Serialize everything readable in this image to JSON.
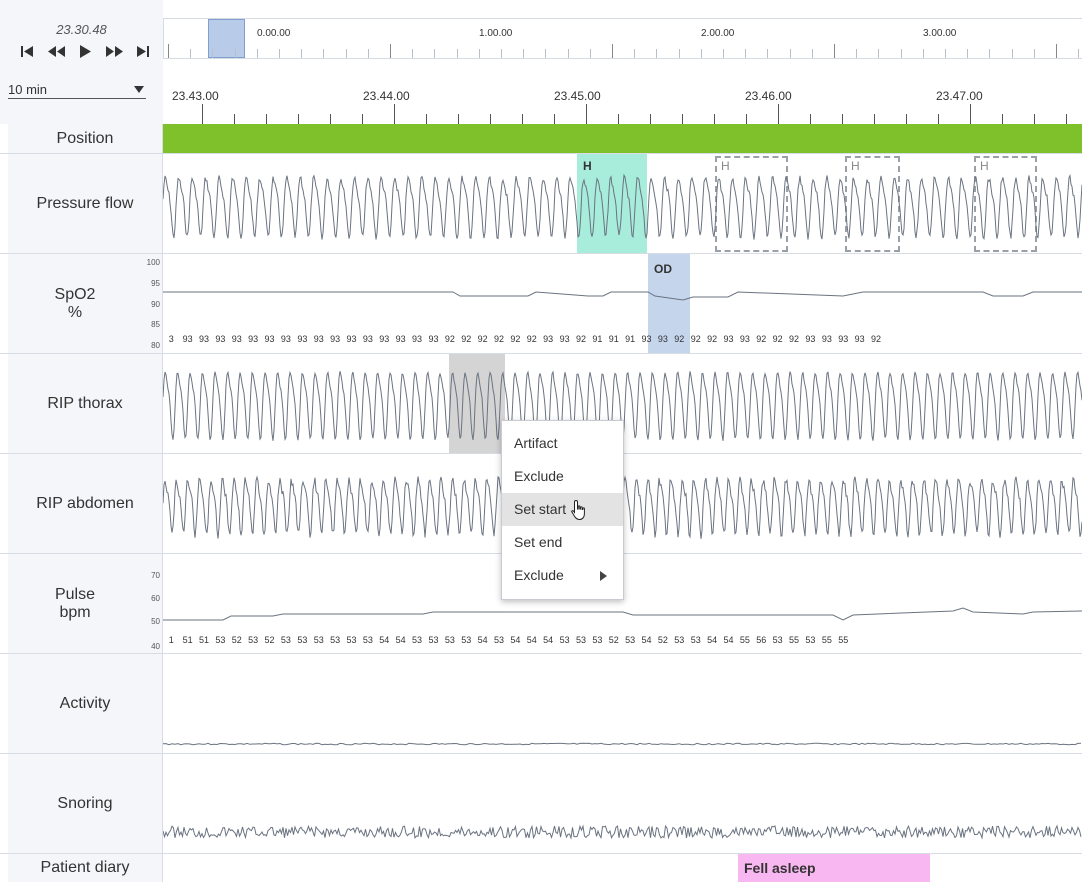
{
  "header": {
    "current_time": "23.30.48",
    "zoom_level": "10 min"
  },
  "transport": {
    "icons": [
      "skip-to-start-icon",
      "rewind-icon",
      "play-icon",
      "fast-forward-icon",
      "skip-to-end-icon"
    ]
  },
  "overview": {
    "labels": [
      "0.00.00",
      "1.00.00",
      "2.00.00",
      "3.00.00"
    ]
  },
  "timeaxis": {
    "labels": [
      "23.43.00",
      "23.44.00",
      "23.45.00",
      "23.46.00",
      "23.47.00"
    ]
  },
  "tracks": {
    "position": {
      "label": "Position",
      "color": "#7ec12a"
    },
    "pressure_flow": {
      "label": "Pressure flow",
      "events": [
        "H",
        "H",
        "H",
        "H"
      ],
      "highlight_color": "#a8ecdc"
    },
    "spo2": {
      "label": "SpO2",
      "unit": "%",
      "scale": [
        "100",
        "95",
        "90",
        "85",
        "80"
      ],
      "event": "OD",
      "event_color": "#c5d5ec",
      "values": [
        "3",
        "93",
        "93",
        "93",
        "93",
        "93",
        "93",
        "93",
        "93",
        "93",
        "93",
        "93",
        "93",
        "93",
        "93",
        "93",
        "93",
        "92",
        "92",
        "92",
        "92",
        "92",
        "92",
        "93",
        "93",
        "92",
        "91",
        "91",
        "91",
        "93",
        "93",
        "92",
        "92",
        "92",
        "93",
        "93",
        "92",
        "92",
        "92",
        "93",
        "93",
        "93",
        "93",
        "92"
      ]
    },
    "rip_thorax": {
      "label": "RIP thorax",
      "artifact_color": "#d4d4d4"
    },
    "rip_abdomen": {
      "label": "RIP abdomen"
    },
    "pulse": {
      "label": "Pulse",
      "unit": "bpm",
      "scale": [
        "70",
        "60",
        "50",
        "40"
      ],
      "values": [
        "1",
        "51",
        "51",
        "53",
        "52",
        "53",
        "52",
        "53",
        "53",
        "53",
        "53",
        "53",
        "53",
        "54",
        "54",
        "53",
        "53",
        "53",
        "53",
        "54",
        "53",
        "54",
        "54",
        "54",
        "53",
        "53",
        "53",
        "52",
        "53",
        "54",
        "52",
        "53",
        "53",
        "54",
        "54",
        "55",
        "56",
        "53",
        "55",
        "53",
        "55",
        "55"
      ]
    },
    "activity": {
      "label": "Activity"
    },
    "snoring": {
      "label": "Snoring"
    },
    "patient_diary": {
      "label": "Patient diary",
      "event": "Fell asleep",
      "event_color": "#f8b7f0"
    }
  },
  "context_menu": {
    "items": [
      "Artifact",
      "Exclude",
      "Set start",
      "Set end",
      "Exclude"
    ],
    "hovered": "Set start"
  }
}
